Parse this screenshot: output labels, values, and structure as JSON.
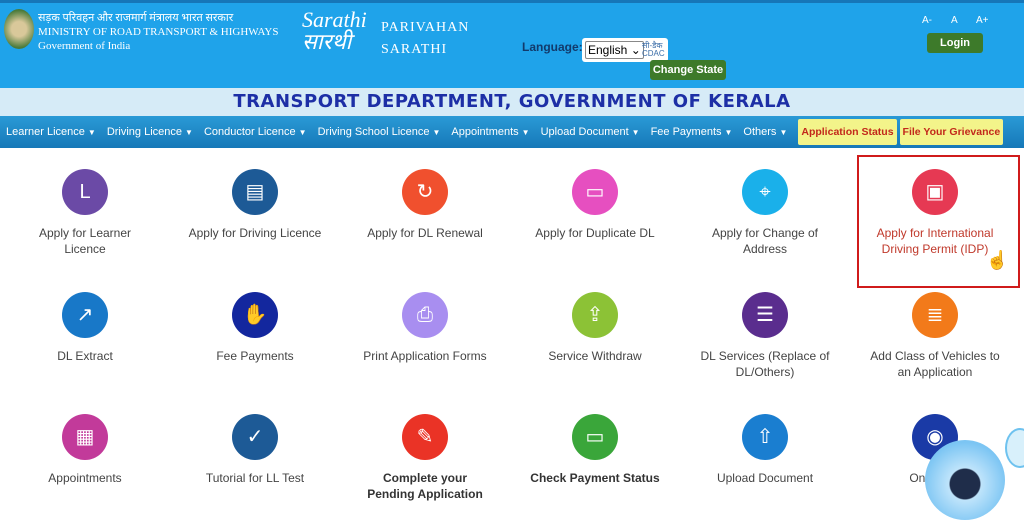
{
  "header": {
    "ministry_hindi": "सड़क परिवहन और राजमार्ग मंत्रालय भारत सरकार",
    "ministry_english": "MINISTRY OF ROAD TRANSPORT & HIGHWAYS",
    "government": "Government of India",
    "logo_text": "Sarathi सारथी",
    "brand_line1": "PARIVAHAN",
    "brand_line2": "SARATHI",
    "language_label": "Language:",
    "language_value": "English",
    "cdac_logo": "सी-डैक CDAC",
    "change_state": "Change State",
    "font_decrease": "A-",
    "font_normal": "A",
    "font_increase": "A+",
    "login": "Login"
  },
  "title": "TRANSPORT DEPARTMENT, GOVERNMENT OF KERALA",
  "nav": {
    "items": [
      "Learner Licence",
      "Driving Licence",
      "Conductor Licence",
      "Driving School Licence",
      "Appointments",
      "Upload Document",
      "Fee Payments",
      "Others"
    ],
    "highlight": [
      "Application Status",
      "File Your Grievance"
    ]
  },
  "tiles": [
    {
      "label": "Apply for Learner Licence",
      "icon": "learner-l-icon",
      "color": "#6b4aa6"
    },
    {
      "label": "Apply for Driving Licence",
      "icon": "id-card-icon",
      "color": "#1d5a96"
    },
    {
      "label": "Apply for DL Renewal",
      "icon": "renewal-icon",
      "color": "#f0502e"
    },
    {
      "label": "Apply for Duplicate DL",
      "icon": "duplicate-card-icon",
      "color": "#e64fc0"
    },
    {
      "label": "Apply for Change of Address",
      "icon": "map-pin-icon",
      "color": "#1ab0ea"
    },
    {
      "label": "Apply for International Driving Permit (IDP)",
      "icon": "badge-icon",
      "color": "#e63953"
    },
    {
      "label": "DL Extract",
      "icon": "share-icon",
      "color": "#1878c8"
    },
    {
      "label": "Fee Payments",
      "icon": "payment-hand-icon",
      "color": "#13279e"
    },
    {
      "label": "Print Application Forms",
      "icon": "printer-icon",
      "color": "#a88ef0"
    },
    {
      "label": "Service Withdraw",
      "icon": "upload-tray-icon",
      "color": "#8cc236"
    },
    {
      "label": "DL Services (Replace of DL/Others)",
      "icon": "profile-card-icon",
      "color": "#5a2d8e"
    },
    {
      "label": "Add Class of Vehicles to an Application",
      "icon": "list-form-icon",
      "color": "#f27a1a"
    },
    {
      "label": "Appointments",
      "icon": "calendar-icon",
      "color": "#c23a9a"
    },
    {
      "label": "Tutorial for LL Test",
      "icon": "clipboard-check-icon",
      "color": "#1d5a96"
    },
    {
      "label": "Complete your Pending Application",
      "icon": "clipboard-pending-icon",
      "color": "#ea3326"
    },
    {
      "label": "Check Payment Status",
      "icon": "payment-card-icon",
      "color": "#3aa63a"
    },
    {
      "label": "Upload Document",
      "icon": "upload-icon",
      "color": "#1a7ed0"
    },
    {
      "label": "Online LL",
      "icon": "online-ll-icon",
      "color": "#1a3aa6"
    }
  ]
}
